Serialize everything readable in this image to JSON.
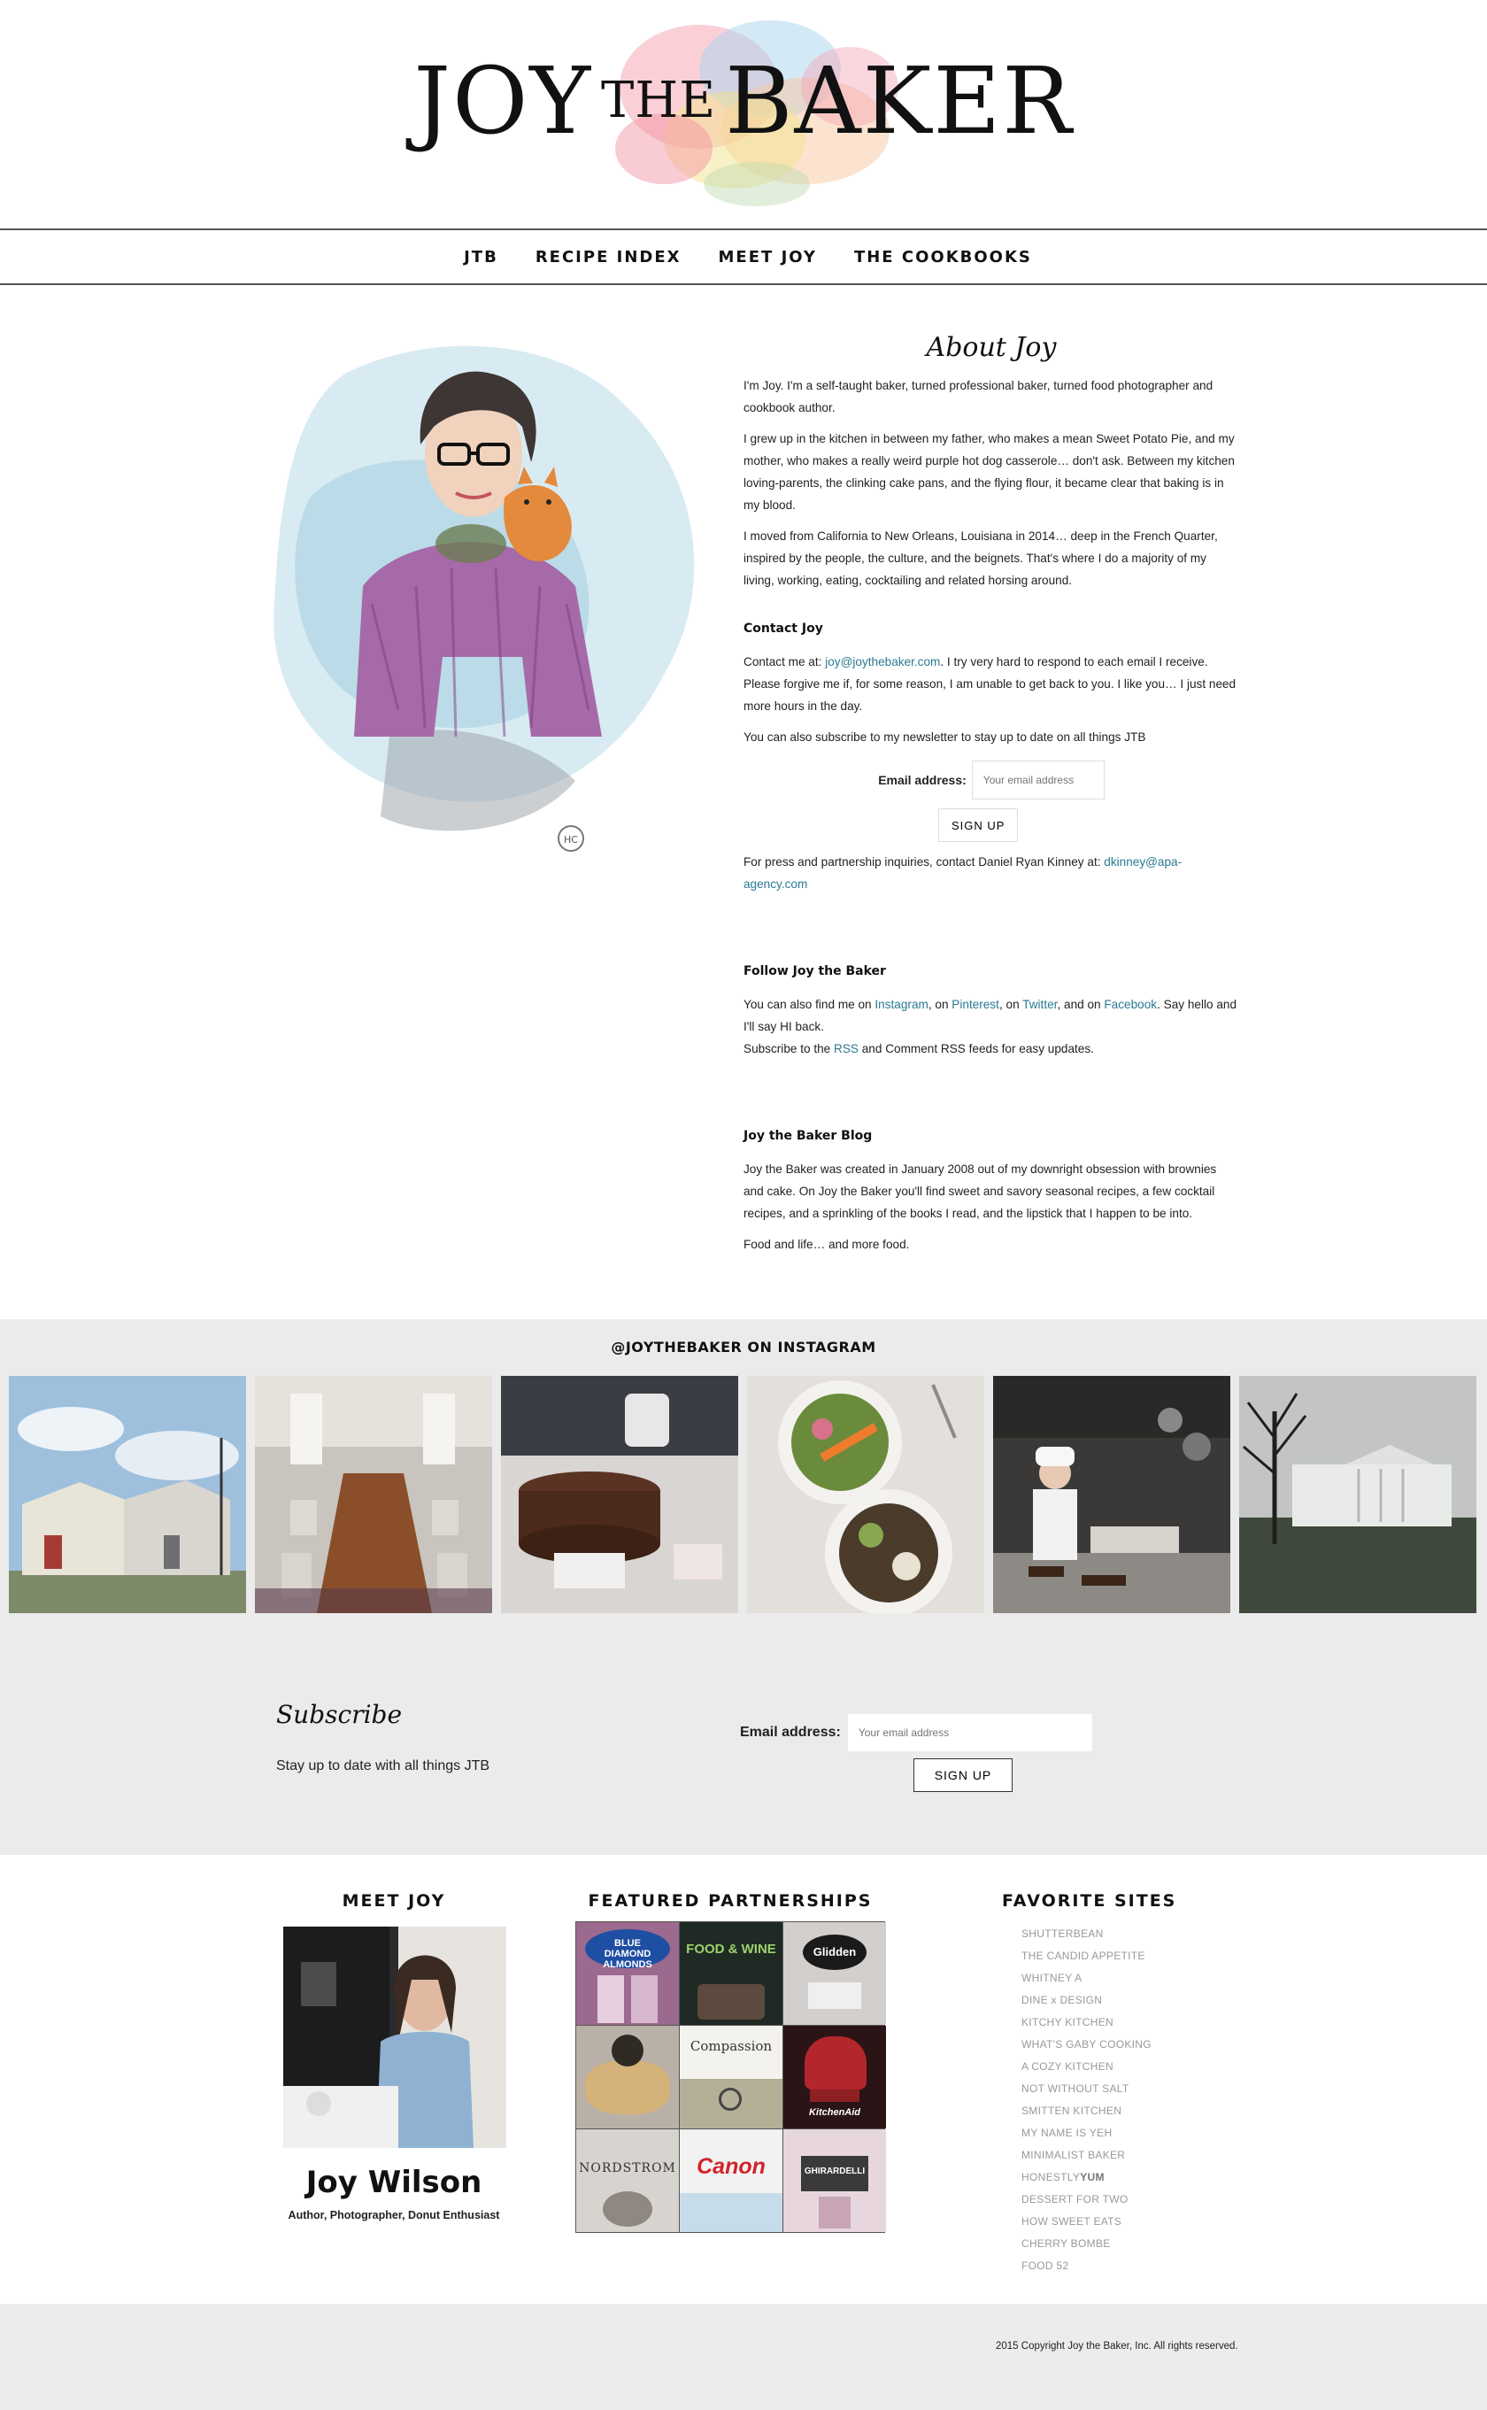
{
  "header": {
    "logo_main_left": "JOY",
    "logo_the": "THE",
    "logo_main_right": "BAKER"
  },
  "nav": {
    "items": [
      "JTB",
      "RECIPE INDEX",
      "MEET JOY",
      "THE COOKBOOKS"
    ]
  },
  "about": {
    "title": "About Joy",
    "p1": "I'm Joy. I'm a self-taught baker, turned professional baker, turned food photographer and cookbook author.",
    "p2": "I grew up in the kitchen in between my father, who makes a mean Sweet Potato Pie, and my mother, who makes a really weird purple hot dog casserole… don't ask. Between my kitchen loving-parents, the clinking cake pans, and the flying flour, it became clear that baking is in my blood.",
    "p3": "I moved from California to New Orleans, Louisiana in 2014… deep in the French Quarter, inspired by the people, the culture, and the beignets. That's where I do a majority of my living, working, eating, cocktailing and related horsing around.",
    "contact_heading": "Contact Joy",
    "contact_pre": "Contact me at: ",
    "contact_email": "joy@joythebaker.com",
    "contact_post": ". I try very hard to respond to each email I receive. Please forgive me if, for some reason, I am unable to get back to you. I like you… I just need more hours in the day.",
    "newsletter_text": "You can also subscribe to my newsletter to stay up to date on all things JTB",
    "email_label": "Email address:",
    "email_placeholder": "Your email address",
    "signup_label": "SIGN UP",
    "press_pre": "For press and partnership inquiries, contact Daniel Ryan Kinney at: ",
    "press_email": "dkinney@apa-agency.com",
    "follow_heading": "Follow Joy the Baker",
    "follow_1": "You can also find me on ",
    "follow_instagram": "Instagram",
    "follow_2": ", on ",
    "follow_pinterest": "Pinterest",
    "follow_3": ", on ",
    "follow_twitter": "Twitter",
    "follow_4": ", and on ",
    "follow_facebook": "Facebook",
    "follow_5": ". Say hello and I'll say HI back.",
    "rss_pre": "Subscribe to the ",
    "rss_link": "RSS",
    "rss_post": " and Comment RSS feeds for easy updates.",
    "blog_heading": "Joy the Baker Blog",
    "blog_p1": "Joy the Baker was created in January 2008 out of my downright obsession with brownies and cake. On Joy the Baker you'll find sweet and savory seasonal recipes, a few cocktail recipes, and a sprinkling of the books I read, and the lipstick that I happen to be into.",
    "blog_p2": "Food and life… and more food."
  },
  "instagram": {
    "title": "@JOYTHEBAKER ON INSTAGRAM"
  },
  "subscribe": {
    "title": "Subscribe",
    "text": "Stay up to date with all things JTB",
    "email_label": "Email address:",
    "email_placeholder": "Your email address",
    "signup_label": "SIGN UP"
  },
  "widgets": {
    "meet_title": "MEET JOY",
    "meet_name": "Joy Wilson",
    "meet_tagline": "Author, Photographer, Donut Enthusiast",
    "partners_title": "FEATURED PARTNERSHIPS",
    "partner_labels": [
      "BLUE DIAMOND ALMONDS",
      "FOOD & WINE",
      "Glidden",
      "",
      "Compassion",
      "KitchenAid",
      "NORDSTROM",
      "Canon",
      "GHIRARDELLI"
    ],
    "sites_title": "FAVORITE SITES",
    "sites": [
      "SHUTTERBEAN",
      "THE CANDID APPETITE",
      "WHITNEY A",
      "DINE x DESIGN",
      "KITCHY KITCHEN",
      "WHAT'S GABY COOKING",
      "A COZY KITCHEN",
      "NOT WITHOUT SALT",
      "SMITTEN KITCHEN",
      "MY NAME IS YEH",
      "MINIMALIST BAKER",
      "HONESTLY",
      "DESSERT FOR TWO",
      "HOW SWEET EATS",
      "CHERRY BOMBE",
      "FOOD 52"
    ],
    "honestly_suffix": "YUM"
  },
  "footer": {
    "copyright": "2015 Copyright Joy the Baker, Inc. All rights reserved."
  }
}
